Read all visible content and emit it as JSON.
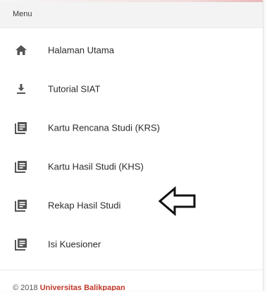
{
  "menu": {
    "header": "Menu",
    "items": [
      {
        "label": "Halaman Utama",
        "icon": "home-icon"
      },
      {
        "label": "Tutorial SIAT",
        "icon": "download-icon"
      },
      {
        "label": "Kartu Rencana Studi (KRS)",
        "icon": "document-list-icon"
      },
      {
        "label": "Kartu Hasil Studi (KHS)",
        "icon": "document-list-icon"
      },
      {
        "label": "Rekap Hasil Studi",
        "icon": "document-list-icon"
      },
      {
        "label": "Isi Kuesioner",
        "icon": "document-list-icon"
      }
    ]
  },
  "annotation": {
    "icon": "arrow-left-outline-icon",
    "points_to": "Rekap Hasil Studi"
  },
  "footer": {
    "copyright": "© 2018",
    "brand": "Universitas Balikpapan"
  },
  "colors": {
    "icon": "#555555",
    "text": "#2b2b2b",
    "brand": "#c0392b",
    "header_bg": "#f3f3f3"
  }
}
